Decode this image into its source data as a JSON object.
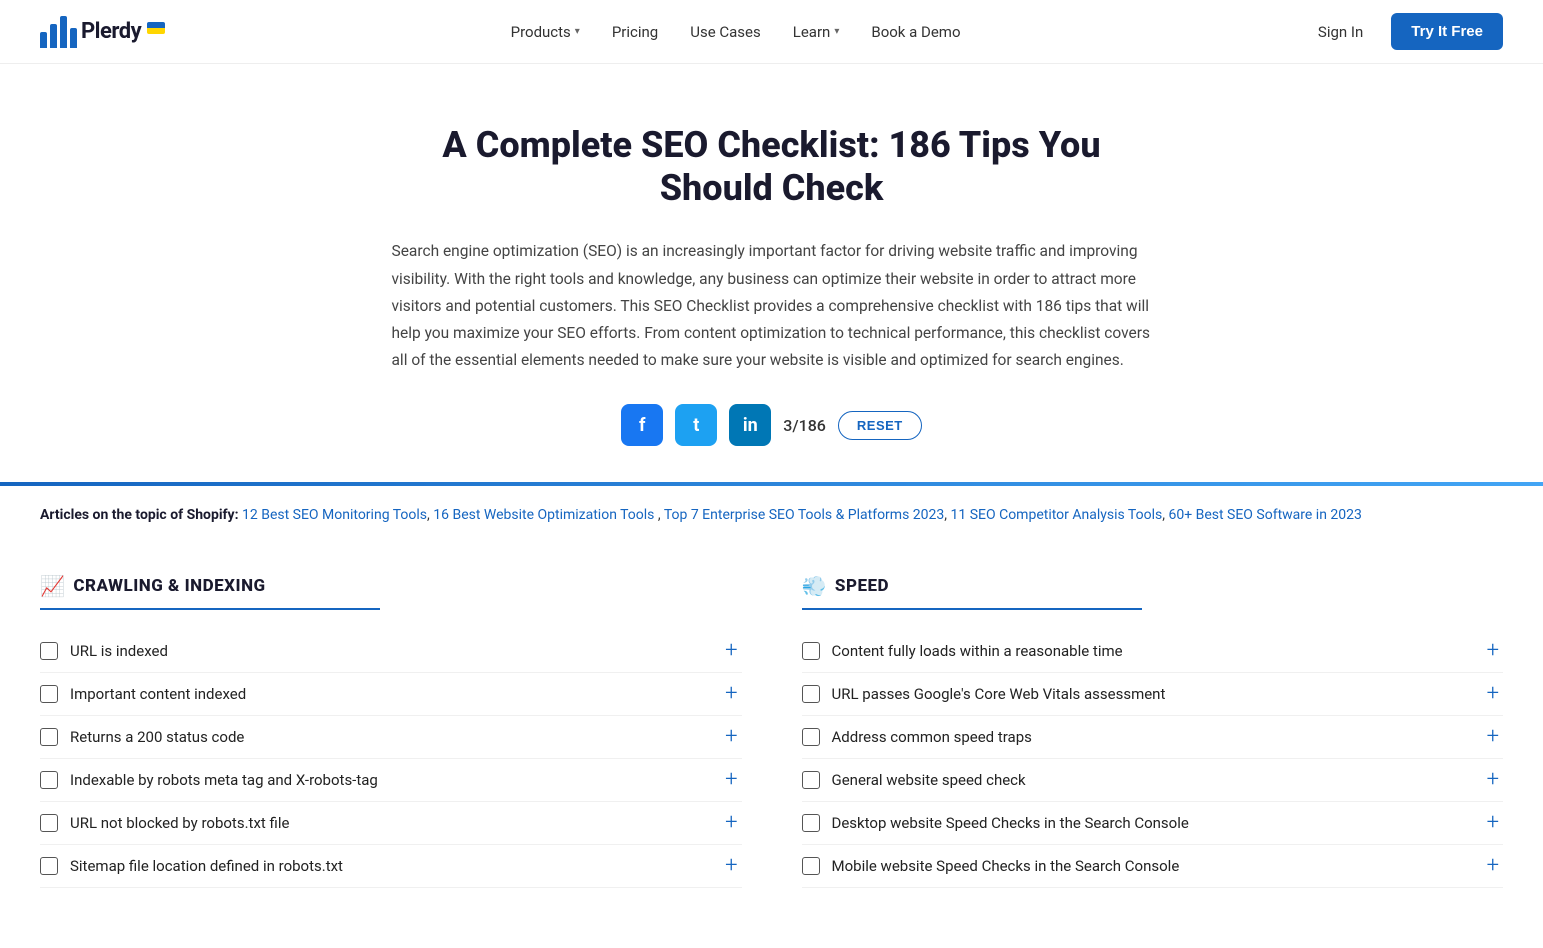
{
  "header": {
    "logo_text": "Plerdy",
    "nav_items": [
      {
        "label": "Products",
        "has_dropdown": true
      },
      {
        "label": "Pricing",
        "has_dropdown": false
      },
      {
        "label": "Use Cases",
        "has_dropdown": false
      },
      {
        "label": "Learn",
        "has_dropdown": true
      },
      {
        "label": "Book a Demo",
        "has_dropdown": false
      }
    ],
    "sign_in_label": "Sign In",
    "try_free_label": "Try It Free"
  },
  "hero": {
    "title": "A Complete SEO Checklist: 186 Tips You Should Check",
    "description": "Search engine optimization (SEO) is an increasingly important factor for driving website traffic and improving visibility. With the right tools and knowledge, any business can optimize their website in order to attract more visitors and potential customers. This SEO Checklist provides a comprehensive checklist with 186 tips that will help you maximize your SEO efforts. From content optimization to technical performance, this checklist covers all of the essential elements needed to make sure your website is visible and optimized for search engines."
  },
  "social_row": {
    "counter": "3/186",
    "reset_label": "RESET",
    "fb_letter": "f",
    "tw_letter": "t",
    "li_letter": "in"
  },
  "articles": {
    "prefix": "Articles on the topic of Shopify:",
    "links": [
      "12 Best SEO Monitoring Tools",
      "16 Best Website Optimization Tools",
      "Top 7 Enterprise SEO Tools & Platforms 2023",
      "11 SEO Competitor Analysis Tools",
      "60+ Best SEO Software in 2023"
    ]
  },
  "crawling_section": {
    "title": "CRAWLING & INDEXING",
    "emoji": "📈",
    "items": [
      {
        "label": "URL is indexed"
      },
      {
        "label": "Important content indexed"
      },
      {
        "label": "Returns a 200 status code"
      },
      {
        "label": "Indexable by robots meta tag and X-robots-tag"
      },
      {
        "label": "URL not blocked by robots.txt file"
      },
      {
        "label": "Sitemap file location defined in robots.txt"
      }
    ]
  },
  "speed_section": {
    "title": "SPEED",
    "emoji": "💨",
    "items": [
      {
        "label": "Content fully loads within a reasonable time"
      },
      {
        "label": "URL passes Google's Core Web Vitals assessment"
      },
      {
        "label": "Address common speed traps"
      },
      {
        "label": "General website speed check"
      },
      {
        "label": "Desktop website Speed Checks in the Search Console"
      },
      {
        "label": "Mobile website Speed Checks in the Search Console"
      }
    ]
  }
}
